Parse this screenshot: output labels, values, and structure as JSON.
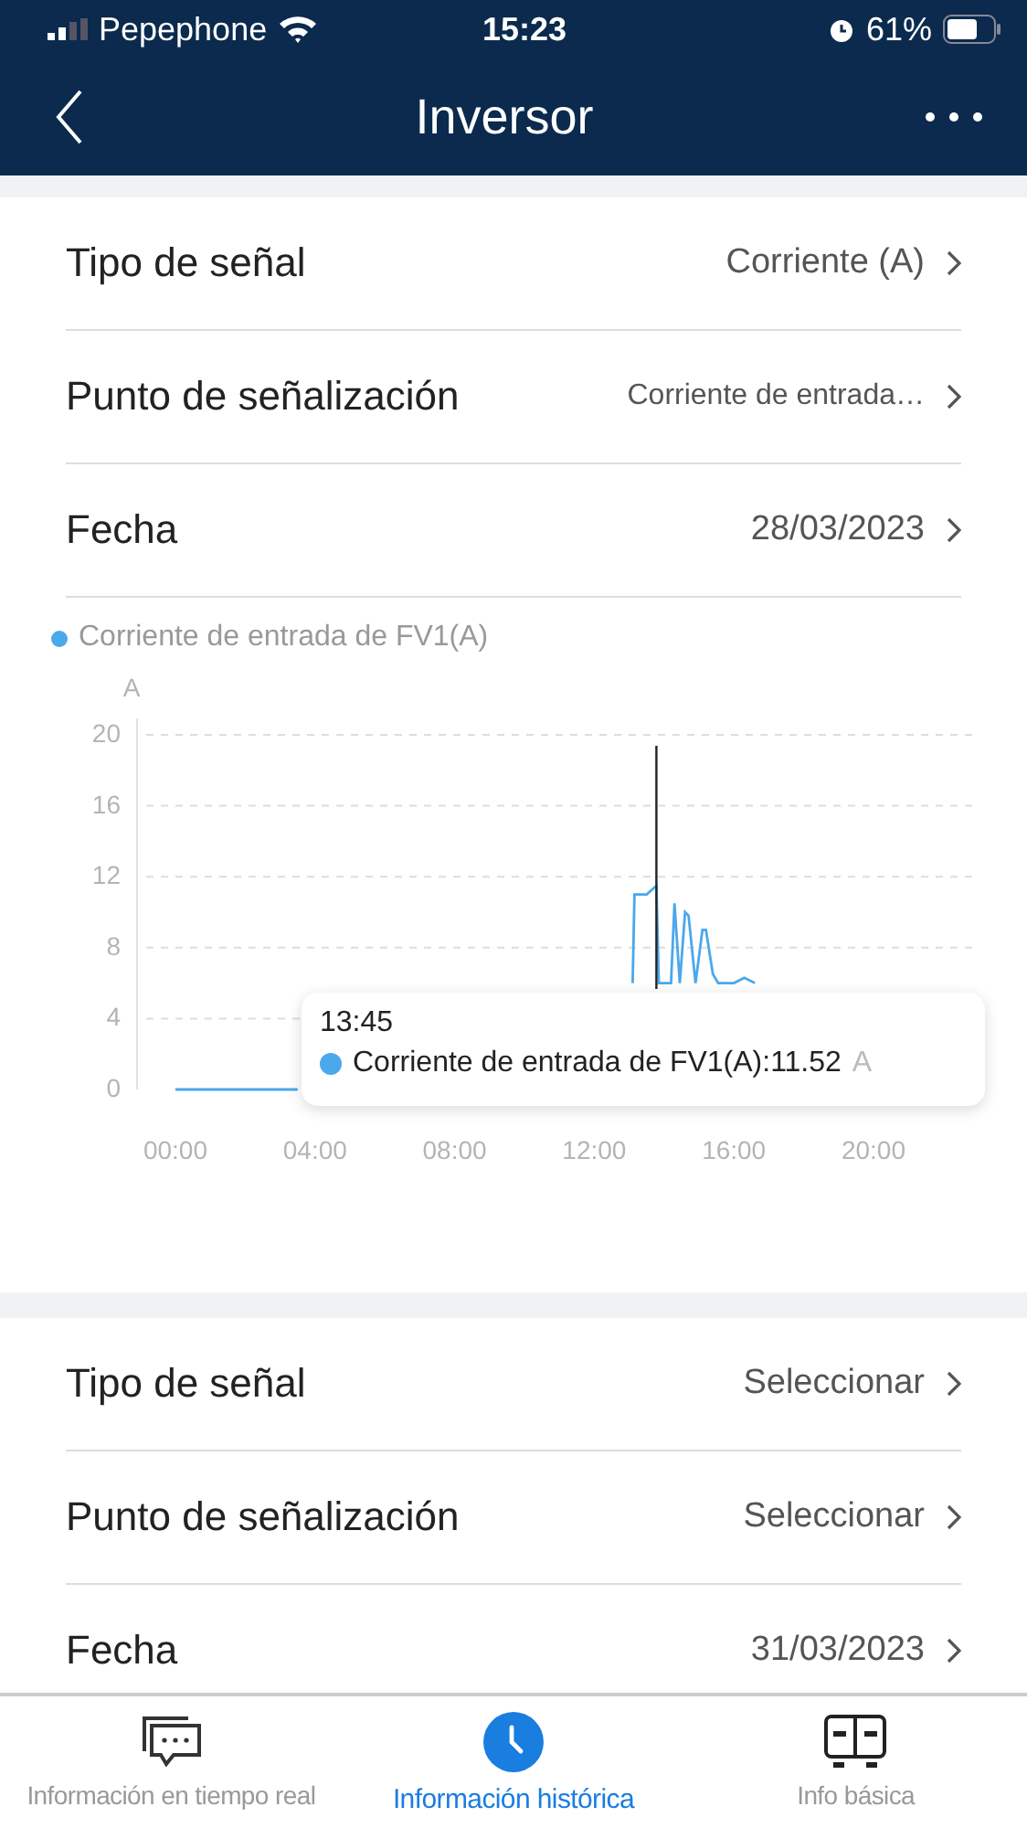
{
  "status_bar": {
    "carrier": "Pepephone",
    "time": "15:23",
    "battery": "61%"
  },
  "header": {
    "title": "Inversor"
  },
  "query_1": {
    "rows": [
      {
        "label": "Tipo de señal",
        "value": "Corriente (A)",
        "kind": "normal"
      },
      {
        "label": "Punto de señalización",
        "value": "Corriente de entrada…",
        "kind": "small"
      },
      {
        "label": "Fecha",
        "value": "28/03/2023",
        "kind": "normal"
      }
    ],
    "chart": {
      "chart_data": {
        "type": "line",
        "ylabel": "A",
        "xlim": [
          -1.1,
          23
        ],
        "ylim": [
          0,
          20
        ],
        "grid": true,
        "xticks": [
          {
            "value": 0,
            "label": "00:00"
          },
          {
            "value": 4,
            "label": "04:00"
          },
          {
            "value": 8,
            "label": "08:00"
          },
          {
            "value": 12,
            "label": "12:00"
          },
          {
            "value": 16,
            "label": "16:00"
          },
          {
            "value": 20,
            "label": "20:00"
          }
        ],
        "yticks": [
          0,
          4,
          8,
          12,
          16,
          20
        ],
        "x": [
          0,
          3.5,
          13.1,
          13.15,
          13.5,
          13.78,
          13.85,
          14.2,
          14.3,
          14.45,
          14.6,
          14.7,
          14.9,
          15.1,
          15.2,
          15.4,
          15.55,
          16.0,
          16.3,
          16.6
        ],
        "series": [
          {
            "name": "Corriente de entrada de FV1(A)",
            "color": "#4aa8ec",
            "values": [
              0,
              0,
              6,
              11,
              11,
              11.5,
              6,
              6,
              10.5,
              6,
              10,
              9.8,
              6,
              9,
              9,
              6.5,
              6,
              6,
              6.3,
              6
            ]
          }
        ],
        "ref_lines": [
          {
            "axis": "x",
            "value": 13.78
          }
        ]
      },
      "tooltip": {
        "time": "13:45",
        "text": "Corriente de entrada de FV1(A):11.52",
        "unit": "A"
      }
    }
  },
  "query_2": {
    "rows": [
      {
        "label": "Tipo de señal",
        "value": "Seleccionar"
      },
      {
        "label": "Punto de señalización",
        "value": "Seleccionar"
      },
      {
        "label": "Fecha",
        "value": "31/03/2023"
      }
    ]
  },
  "tabs": [
    {
      "label": "Información en tiempo real",
      "selected": false,
      "kind": "chat"
    },
    {
      "label": "Información histórica",
      "selected": true,
      "kind": "clock"
    },
    {
      "label": "Info básica",
      "selected": false,
      "kind": "panel"
    }
  ]
}
